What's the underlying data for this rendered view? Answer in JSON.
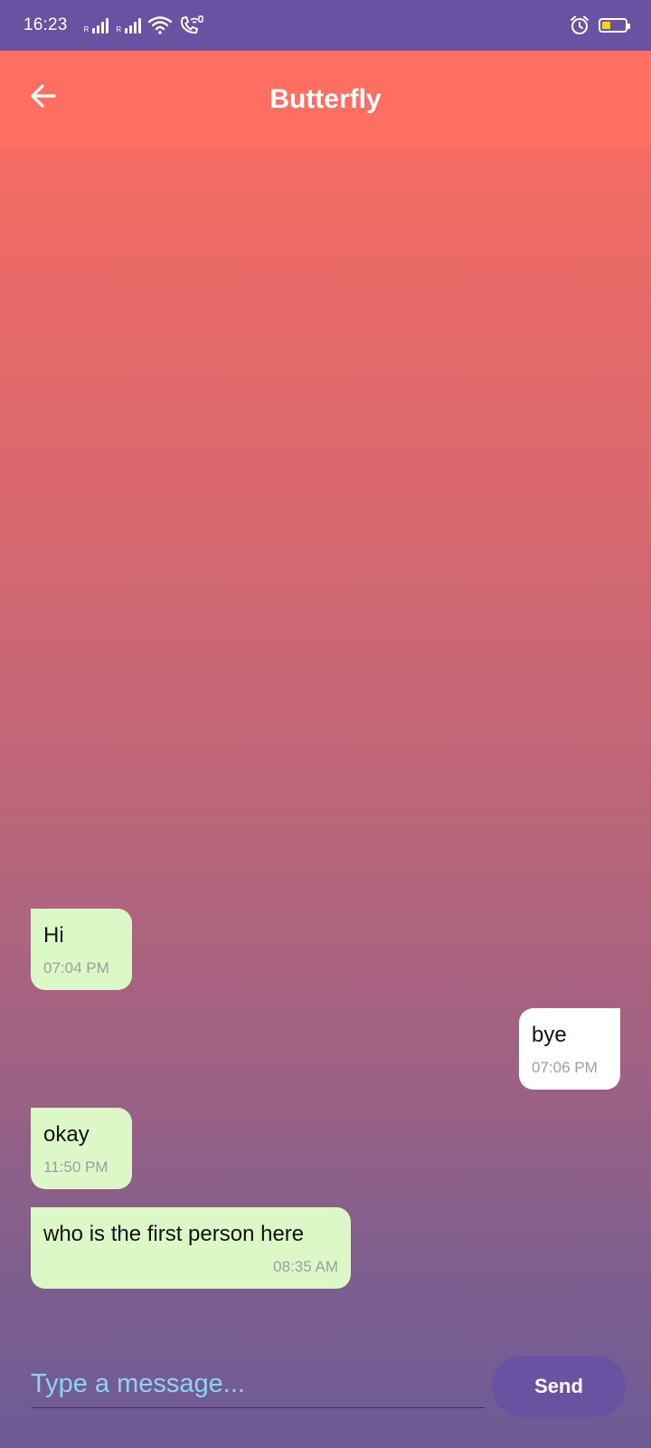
{
  "status_bar": {
    "time": "16:23",
    "sim1_label": "R",
    "sim2_label": "R",
    "battery_color": "#ffd21e",
    "icons": [
      "signal-icon",
      "signal-icon",
      "wifi-icon",
      "wifi-call-icon",
      "alarm-icon",
      "battery-icon"
    ]
  },
  "header": {
    "title": "Butterfly",
    "back_icon": "arrow-left-icon"
  },
  "messages": [
    {
      "text": "Hi",
      "time": "07:04 PM",
      "side": "incoming"
    },
    {
      "text": "bye",
      "time": "07:06 PM",
      "side": "outgoing"
    },
    {
      "text": "okay",
      "time": "11:50 PM",
      "side": "incoming"
    },
    {
      "text": "who is the first person here",
      "time": "08:35 AM",
      "side": "incoming"
    }
  ],
  "composer": {
    "placeholder": "Type a message...",
    "value": "",
    "send_label": "Send"
  },
  "colors": {
    "status_bar": "#6a52a3",
    "app_bar": "#ff6f61",
    "incoming_bubble": "#dcf8c6",
    "outgoing_bubble": "#ffffff",
    "send_button": "#6a52a3",
    "placeholder": "#8ed3f0"
  }
}
